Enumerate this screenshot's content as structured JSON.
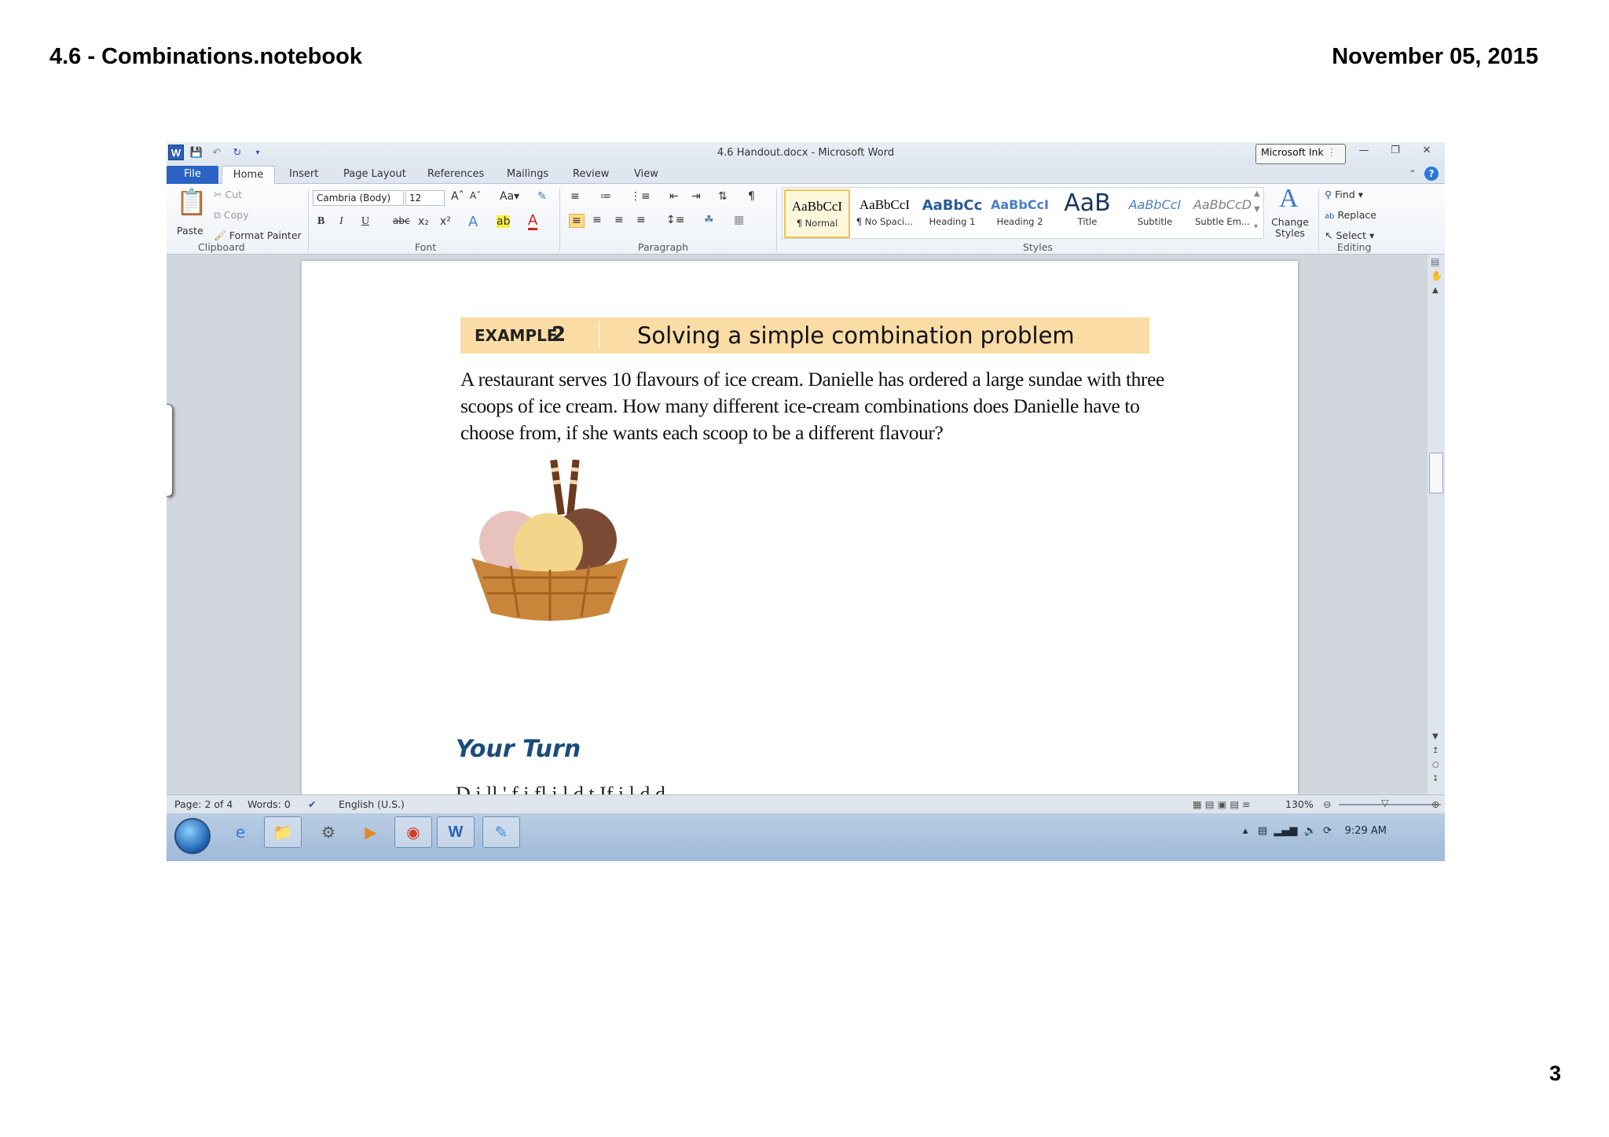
{
  "notebook": {
    "title": "4.6 - Combinations.notebook",
    "date": "November 05, 2015",
    "page_number": "3"
  },
  "word": {
    "window_title": "4.6 Handout.docx - Microsoft Word",
    "ink_button": "Microsoft Ink",
    "tabs": [
      "File",
      "Home",
      "Insert",
      "Page Layout",
      "References",
      "Mailings",
      "Review",
      "View"
    ],
    "clipboard": {
      "paste": "Paste",
      "cut": "Cut",
      "copy": "Copy",
      "format_painter": "Format Painter",
      "label": "Clipboard"
    },
    "font": {
      "family": "Cambria (Body)",
      "size": "12",
      "label": "Font"
    },
    "paragraph_label": "Paragraph",
    "styles": {
      "label": "Styles",
      "items": [
        {
          "preview": "AaBbCcI",
          "name": "¶ Normal"
        },
        {
          "preview": "AaBbCcI",
          "name": "¶ No Spaci..."
        },
        {
          "preview": "AaBbCc",
          "name": "Heading 1"
        },
        {
          "preview": "AaBbCcI",
          "name": "Heading 2"
        },
        {
          "preview": "AaB",
          "name": "Title"
        },
        {
          "preview": "AaBbCcI",
          "name": "Subtitle"
        },
        {
          "preview": "AaBbCcD",
          "name": "Subtle Em..."
        }
      ],
      "change_styles": "Change Styles"
    },
    "editing": {
      "find": "Find",
      "replace": "Replace",
      "select": "Select",
      "label": "Editing"
    },
    "document": {
      "example_label": "EXAMPLE",
      "example_number": "2",
      "example_title": "Solving a simple combination problem",
      "body": "A restaurant serves 10 flavours of ice cream. Danielle has ordered a large sundae with three scoops of ice cream. How many different ice-cream combinations does Danielle have to choose from, if she wants each scoop to be a different flavour?",
      "your_turn": "Your Turn",
      "cut_off_line": "D   i  ll ' f        i   fl      i    l    d  t   If              i   l  d           d"
    },
    "status": {
      "page": "Page: 2 of 4",
      "words": "Words: 0",
      "language": "English (U.S.)",
      "zoom": "130%"
    },
    "taskbar": {
      "time": "9:29 AM"
    }
  }
}
